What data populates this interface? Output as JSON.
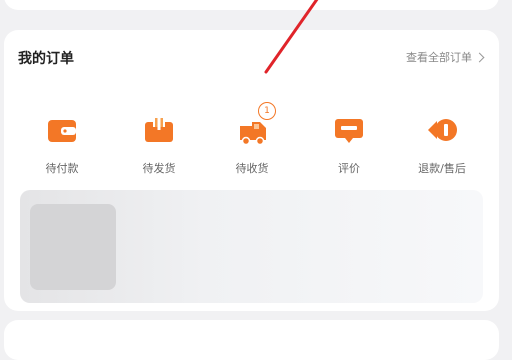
{
  "orders": {
    "title": "我的订单",
    "view_all": "查看全部订单",
    "statuses": [
      {
        "label": "待付款",
        "icon": "wallet-icon"
      },
      {
        "label": "待发货",
        "icon": "package-icon"
      },
      {
        "label": "待收货",
        "icon": "truck-icon",
        "badge": "1"
      },
      {
        "label": "评价",
        "icon": "review-icon"
      },
      {
        "label": "退款/售后",
        "icon": "refund-icon"
      }
    ]
  },
  "colors": {
    "accent": "#f37726",
    "annotation": "#e0242a"
  }
}
